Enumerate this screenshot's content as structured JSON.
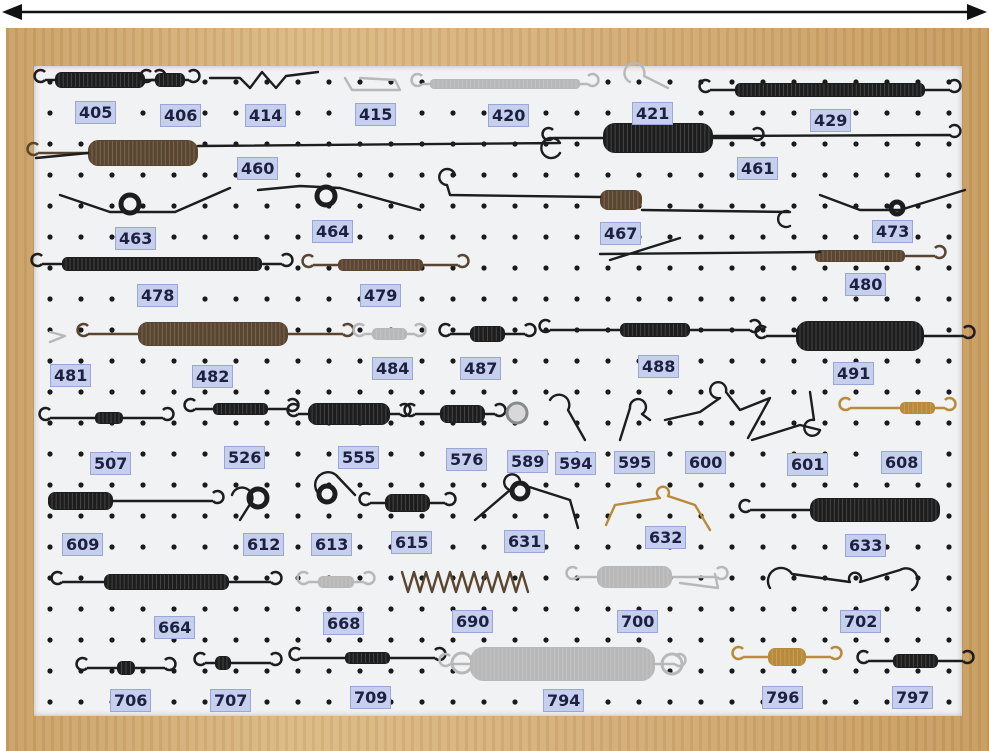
{
  "image": {
    "subject": "pegboard-with-springs",
    "colors": {
      "frame": "#d6b07a",
      "board": "#f1f2f4",
      "hole": "#1a1a1a",
      "label_bg": "#c7cfef",
      "label_text": "#1c2140",
      "spring_dark": "#1d1d1d",
      "spring_bronze": "#5a4630",
      "spring_silver": "#b8b8b8",
      "spring_gold": "#b88a3a"
    }
  },
  "labels": [
    {
      "id": "405"
    },
    {
      "id": "406"
    },
    {
      "id": "414"
    },
    {
      "id": "415"
    },
    {
      "id": "420"
    },
    {
      "id": "421"
    },
    {
      "id": "429"
    },
    {
      "id": "460"
    },
    {
      "id": "461"
    },
    {
      "id": "463"
    },
    {
      "id": "464"
    },
    {
      "id": "467"
    },
    {
      "id": "473"
    },
    {
      "id": "478"
    },
    {
      "id": "479"
    },
    {
      "id": "480"
    },
    {
      "id": "481"
    },
    {
      "id": "482"
    },
    {
      "id": "484"
    },
    {
      "id": "487"
    },
    {
      "id": "488"
    },
    {
      "id": "491"
    },
    {
      "id": "507"
    },
    {
      "id": "526"
    },
    {
      "id": "555"
    },
    {
      "id": "576"
    },
    {
      "id": "589"
    },
    {
      "id": "594"
    },
    {
      "id": "595"
    },
    {
      "id": "600"
    },
    {
      "id": "601"
    },
    {
      "id": "608"
    },
    {
      "id": "609"
    },
    {
      "id": "612"
    },
    {
      "id": "613"
    },
    {
      "id": "615"
    },
    {
      "id": "631"
    },
    {
      "id": "632"
    },
    {
      "id": "633"
    },
    {
      "id": "664"
    },
    {
      "id": "668"
    },
    {
      "id": "690"
    },
    {
      "id": "700"
    },
    {
      "id": "702"
    },
    {
      "id": "706"
    },
    {
      "id": "707"
    },
    {
      "id": "709"
    },
    {
      "id": "794"
    },
    {
      "id": "796"
    },
    {
      "id": "797"
    }
  ]
}
